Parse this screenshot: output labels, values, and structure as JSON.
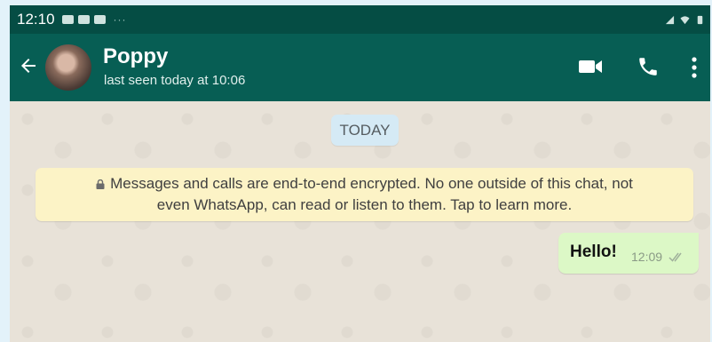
{
  "status_bar": {
    "time": "12:10",
    "icons_left": [
      "image-icon",
      "video-icon",
      "app-icon"
    ],
    "icons_right": [
      "signal-icon",
      "wifi-icon",
      "battery-icon"
    ]
  },
  "header": {
    "contact_name": "Poppy",
    "last_seen": "last seen today at 10:06",
    "icons": [
      "back-arrow-icon",
      "avatar",
      "video-call-icon",
      "phone-call-icon",
      "more-options-icon"
    ]
  },
  "chat": {
    "date_label": "TODAY",
    "encryption_notice": {
      "line1": "Messages and calls are end-to-end encrypted. No one outside of this chat, not",
      "line2": "even WhatsApp, can read or listen to them. Tap to learn more."
    },
    "messages": [
      {
        "text": "Hello!",
        "time": "12:09",
        "status": "read"
      }
    ]
  },
  "colors": {
    "status_bar": "#054d44",
    "app_bar": "#075e54",
    "chat_background": "#e8e2d8",
    "outgoing_bubble": "#dcf8c6",
    "notice_background": "#fcf3c6",
    "date_chip": "#d5eaf5",
    "page_background": "#e3f2fa"
  }
}
